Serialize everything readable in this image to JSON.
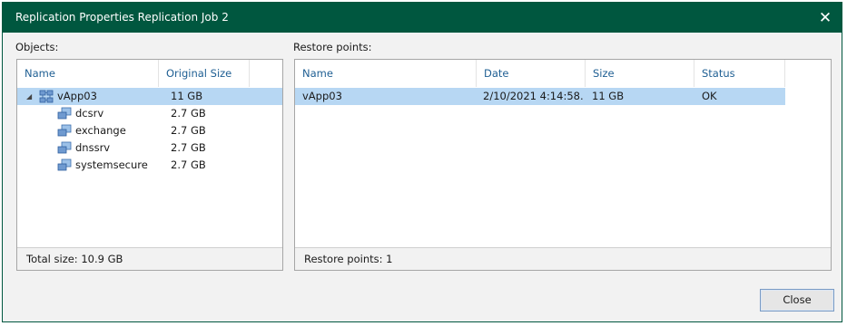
{
  "window": {
    "title": "Replication Properties Replication Job 2"
  },
  "objects": {
    "label": "Objects:",
    "columns": [
      "Name",
      "Original Size"
    ],
    "rows": [
      {
        "name": "vApp03",
        "size": "11 GB"
      },
      {
        "name": "dcsrv",
        "size": "2.7 GB"
      },
      {
        "name": "exchange",
        "size": "2.7 GB"
      },
      {
        "name": "dnssrv",
        "size": "2.7 GB"
      },
      {
        "name": "systemsecure",
        "size": "2.7 GB"
      }
    ],
    "footer": "Total size: 10.9 GB"
  },
  "restore_points": {
    "label": "Restore points:",
    "columns": [
      "Name",
      "Date",
      "Size",
      "Status"
    ],
    "rows": [
      {
        "name": "vApp03",
        "date": "2/10/2021 4:14:58...",
        "size": "11 GB",
        "status": "OK"
      }
    ],
    "footer": "Restore points: 1"
  },
  "buttons": {
    "close": "Close"
  },
  "icons": {
    "window_close": "close-icon",
    "vapp": "vapp-icon",
    "vm": "vm-icon",
    "expander": "collapse-arrow-icon"
  },
  "colors": {
    "titlebar": "#00573f",
    "header_text": "#1f5f93",
    "selected_row": "#b7d7f3"
  }
}
